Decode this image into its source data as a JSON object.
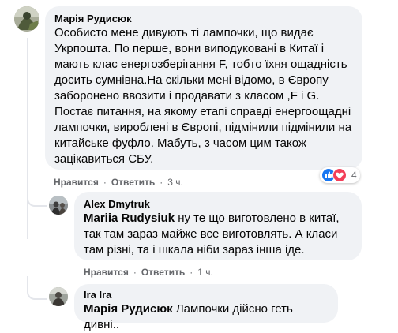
{
  "comments": [
    {
      "author": "Марія Рудисюк",
      "text": "Особисто мене дивують ті лампочки, що видає Укрпошта. По перше, вони виподуковані в Китаї і мають клас енергозберігання F, тобто їхня ощадність досить сумнівна.На скільки мені відомо, в Європу заборонено ввозити і продавати з класом ,F і G. Постає питання, на якому етапі справді енергоощадні лампочки, вироблені в Європі, підмінили підмінили на китайське фуфло. Мабуть, з часом цим також зацікавиться СБУ.",
      "reaction_count": "4",
      "reactions": [
        "like",
        "love"
      ],
      "actions": {
        "like": "Нравится",
        "reply": "Ответить",
        "time": "3 ч."
      }
    },
    {
      "author": "Alex Dmytruk",
      "mention": "Mariia Rudysiuk",
      "text": " ну те що виготовлено в китаї, так там зараз майже все виготовлять. А класи там різні, та і шкала ніби зараз інша іде.",
      "actions": {
        "like": "Нравится",
        "reply": "Ответить",
        "time": "1 ч."
      }
    },
    {
      "author": "Ira Ira",
      "mention": "Марія Рудисюк",
      "text": " Лампочки дійсно геть дивні.."
    }
  ],
  "colors": {
    "like": "#1877f2",
    "love": "#f33e58",
    "bubble": "#f0f2f5",
    "meta": "#65676b"
  }
}
